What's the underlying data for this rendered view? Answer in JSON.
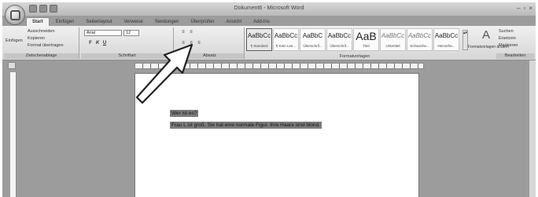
{
  "window": {
    "title": "Dokument6 - Microsoft Word",
    "controls": [
      "–",
      "▫",
      "×"
    ]
  },
  "tabs": [
    "Start",
    "Einfügen",
    "Seitenlayout",
    "Verweise",
    "Sendungen",
    "Überprüfen",
    "Ansicht",
    "Add-Ins"
  ],
  "clipboard": {
    "paste_label": "Einfügen",
    "cut_label": "Ausschneiden",
    "copy_label": "Kopieren",
    "format_painter_label": "Format übertragen",
    "group_label": "Zwischenablage"
  },
  "font": {
    "name": "Arial",
    "size": "12",
    "group_label": "Schriftart"
  },
  "paragraph": {
    "group_label": "Absatz"
  },
  "styles": {
    "items": [
      {
        "preview": "AaBbCc",
        "name": "¶ Standard"
      },
      {
        "preview": "AaBbCc",
        "name": "¶ Kein Lee..."
      },
      {
        "preview": "AaBbC",
        "name": "Überschrif..."
      },
      {
        "preview": "AaBbCc",
        "name": "Überschrif..."
      },
      {
        "preview": "AaB",
        "name": "Titel"
      },
      {
        "preview": "AaBbCc",
        "name": "Untertitel"
      },
      {
        "preview": "AaBbCc",
        "name": "Schwache..."
      },
      {
        "preview": "AaBbCc",
        "name": "Hervorhe..."
      }
    ],
    "group_label": "Formatvorlagen",
    "change_label": "Formatvorlagen ändern"
  },
  "editing": {
    "find_label": "Suchen",
    "replace_label": "Ersetzen",
    "select_label": "Markieren",
    "group_label": "Bearbeiten"
  },
  "document": {
    "line1": "Wer ist es?",
    "line2": "Frau L ist groß.  Sie hat eine normale Figur. Ihre Haare sind blond."
  }
}
